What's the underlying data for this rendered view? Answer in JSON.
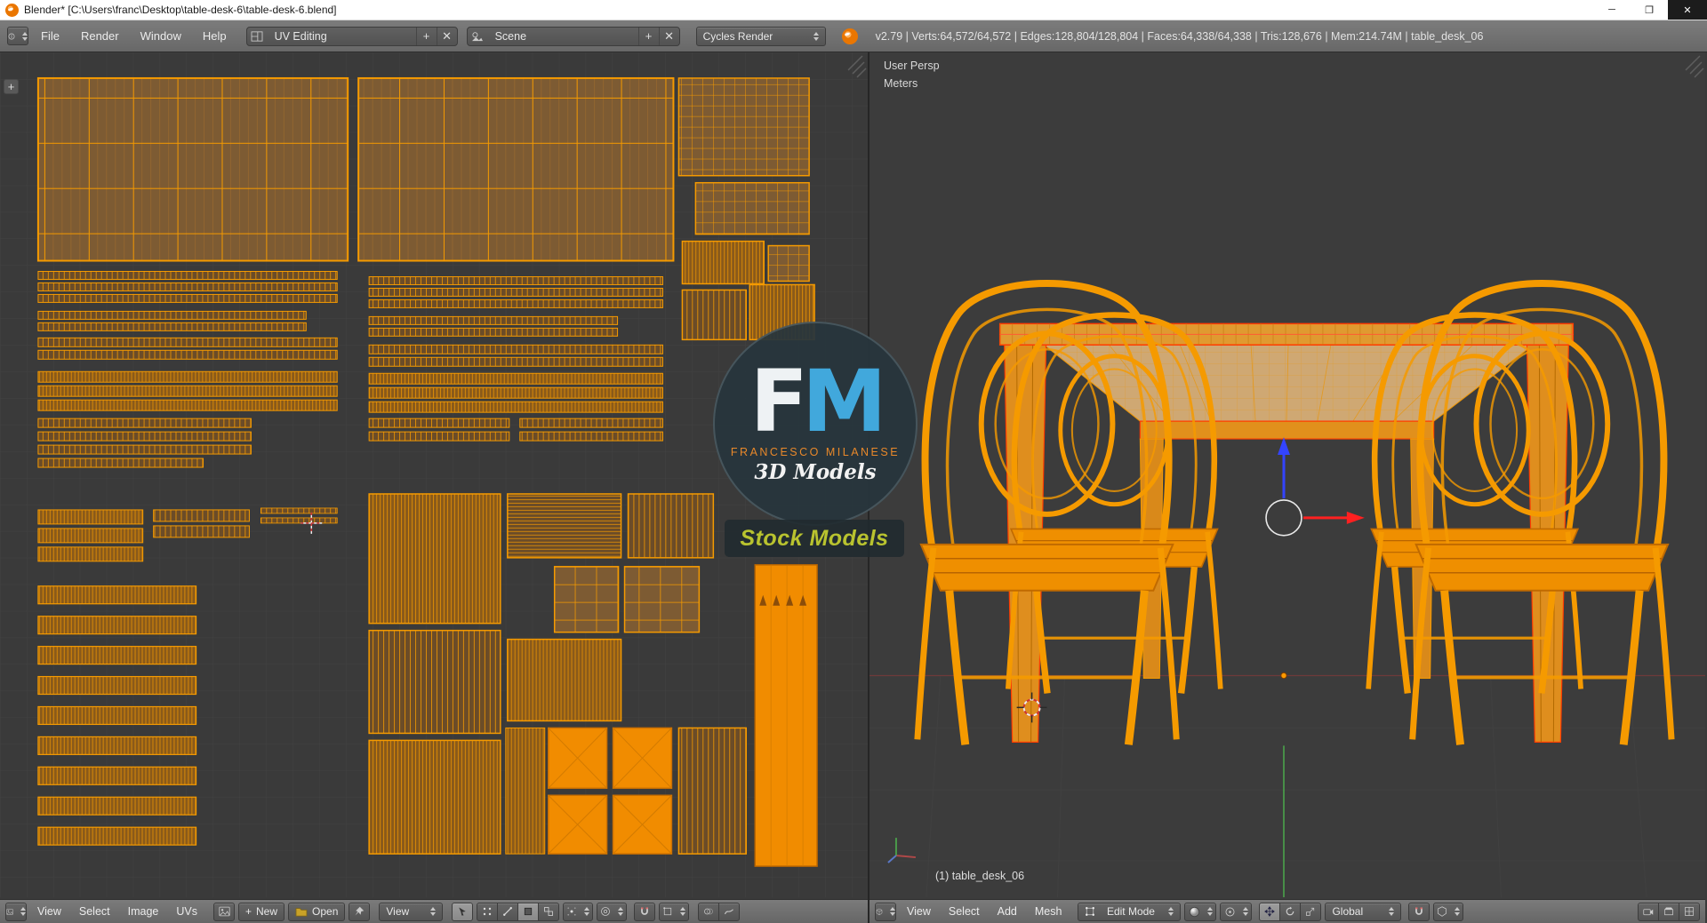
{
  "window": {
    "title": "Blender* [C:\\Users\\franc\\Desktop\\table-desk-6\\table-desk-6.blend]",
    "controls": {
      "minimize": "─",
      "maximize": "❐",
      "close": "✕"
    }
  },
  "icons": {
    "plus": "+",
    "close": "✕"
  },
  "topbar": {
    "menus": [
      "File",
      "Render",
      "Window",
      "Help"
    ],
    "layout_value": "UV Editing",
    "scene_value": "Scene",
    "engine_value": "Cycles Render",
    "stats": "v2.79 | Verts:64,572/64,572 | Edges:128,804/128,804 | Faces:64,338/64,338 | Tris:128,676 | Mem:214.74M | table_desk_06"
  },
  "uv_editor": {
    "menus": [
      "View",
      "Select",
      "Image",
      "UVs"
    ],
    "new_label": "New",
    "open_label": "Open",
    "view_dropdown": "View"
  },
  "viewport": {
    "view_name": "User Persp",
    "units": "Meters",
    "object_info": "(1) table_desk_06",
    "menus": [
      "View",
      "Select",
      "Add",
      "Mesh"
    ],
    "mode_value": "Edit Mode",
    "orientation_value": "Global"
  },
  "watermark": {
    "letter_f": "F",
    "letter_m": "M",
    "name": "FRANCESCO MILANESE",
    "models": "3D Models",
    "stock": "Stock Models"
  },
  "colors": {
    "uv_orange": "#f59a00",
    "selection_red": "#ff3c00",
    "logo_blue": "#41a8dc",
    "stock_text": "#b9c32f",
    "brown_fill": "#7d5b33"
  }
}
